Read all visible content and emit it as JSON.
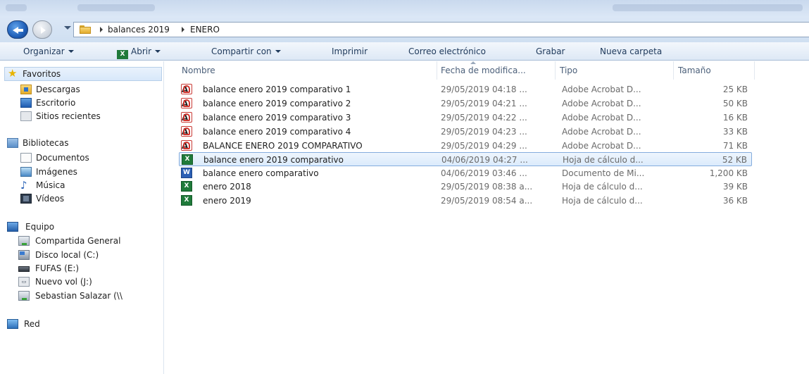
{
  "address": {
    "breadcrumbs": [
      "balances 2019",
      "ENERO"
    ]
  },
  "toolbar": {
    "organize": "Organizar",
    "open": "Abrir",
    "share": "Compartir con",
    "print": "Imprimir",
    "email": "Correo electrónico",
    "burn": "Grabar",
    "new_folder": "Nueva carpeta"
  },
  "sidebar": {
    "favorites": {
      "title": "Favoritos",
      "items": [
        {
          "label": "Descargas",
          "icon": "downloads-folder-icon"
        },
        {
          "label": "Escritorio",
          "icon": "desktop-icon"
        },
        {
          "label": "Sitios recientes",
          "icon": "recent-places-icon"
        }
      ]
    },
    "libraries": {
      "title": "Bibliotecas",
      "items": [
        {
          "label": "Documentos",
          "icon": "documents-icon"
        },
        {
          "label": "Imágenes",
          "icon": "pictures-icon"
        },
        {
          "label": "Música",
          "icon": "music-icon"
        },
        {
          "label": "Vídeos",
          "icon": "videos-icon"
        }
      ]
    },
    "computer": {
      "title": "Equipo",
      "items": [
        {
          "label": "Compartida General",
          "icon": "network-drive-icon"
        },
        {
          "label": "Disco local (C:)",
          "icon": "hard-drive-icon"
        },
        {
          "label": "FUFAS (E:)",
          "icon": "usb-drive-icon"
        },
        {
          "label": "Nuevo vol (J:)",
          "icon": "volume-icon"
        },
        {
          "label": "Sebastian Salazar (\\\\",
          "icon": "network-drive-icon"
        }
      ]
    },
    "network": {
      "title": "Red"
    }
  },
  "columns": {
    "name": "Nombre",
    "date": "Fecha de modifica...",
    "type": "Tipo",
    "size": "Tamaño"
  },
  "files": [
    {
      "name": "balance enero 2019 comparativo 1",
      "date": "29/05/2019 04:18 ...",
      "type": "Adobe Acrobat D...",
      "size": "25 KB",
      "kind": "pdf"
    },
    {
      "name": "balance enero 2019 comparativo 2",
      "date": "29/05/2019 04:21 ...",
      "type": "Adobe Acrobat D...",
      "size": "50 KB",
      "kind": "pdf"
    },
    {
      "name": "balance enero 2019 comparativo 3",
      "date": "29/05/2019 04:22 ...",
      "type": "Adobe Acrobat D...",
      "size": "16 KB",
      "kind": "pdf"
    },
    {
      "name": "balance enero 2019 comparativo 4",
      "date": "29/05/2019 04:23 ...",
      "type": "Adobe Acrobat D...",
      "size": "33 KB",
      "kind": "pdf"
    },
    {
      "name": "BALANCE ENERO 2019 COMPARATIVO",
      "date": "29/05/2019 04:29 ...",
      "type": "Adobe Acrobat D...",
      "size": "71 KB",
      "kind": "pdf"
    },
    {
      "name": "balance enero 2019 comparativo",
      "date": "04/06/2019 04:27 ...",
      "type": "Hoja de cálculo d...",
      "size": "52 KB",
      "kind": "excel",
      "selected": true
    },
    {
      "name": "balance enero comparativo",
      "date": "04/06/2019 03:46 ...",
      "type": "Documento de Mi...",
      "size": "1,200 KB",
      "kind": "word"
    },
    {
      "name": "enero 2018",
      "date": "29/05/2019 08:38 a...",
      "type": "Hoja de cálculo d...",
      "size": "39 KB",
      "kind": "excel"
    },
    {
      "name": "enero 2019",
      "date": "29/05/2019 08:54 a...",
      "type": "Hoja de cálculo d...",
      "size": "36 KB",
      "kind": "excel"
    }
  ],
  "colors": {
    "selection_border": "#84acdd",
    "command_text": "#1e395b",
    "header_text": "#4c607a"
  }
}
